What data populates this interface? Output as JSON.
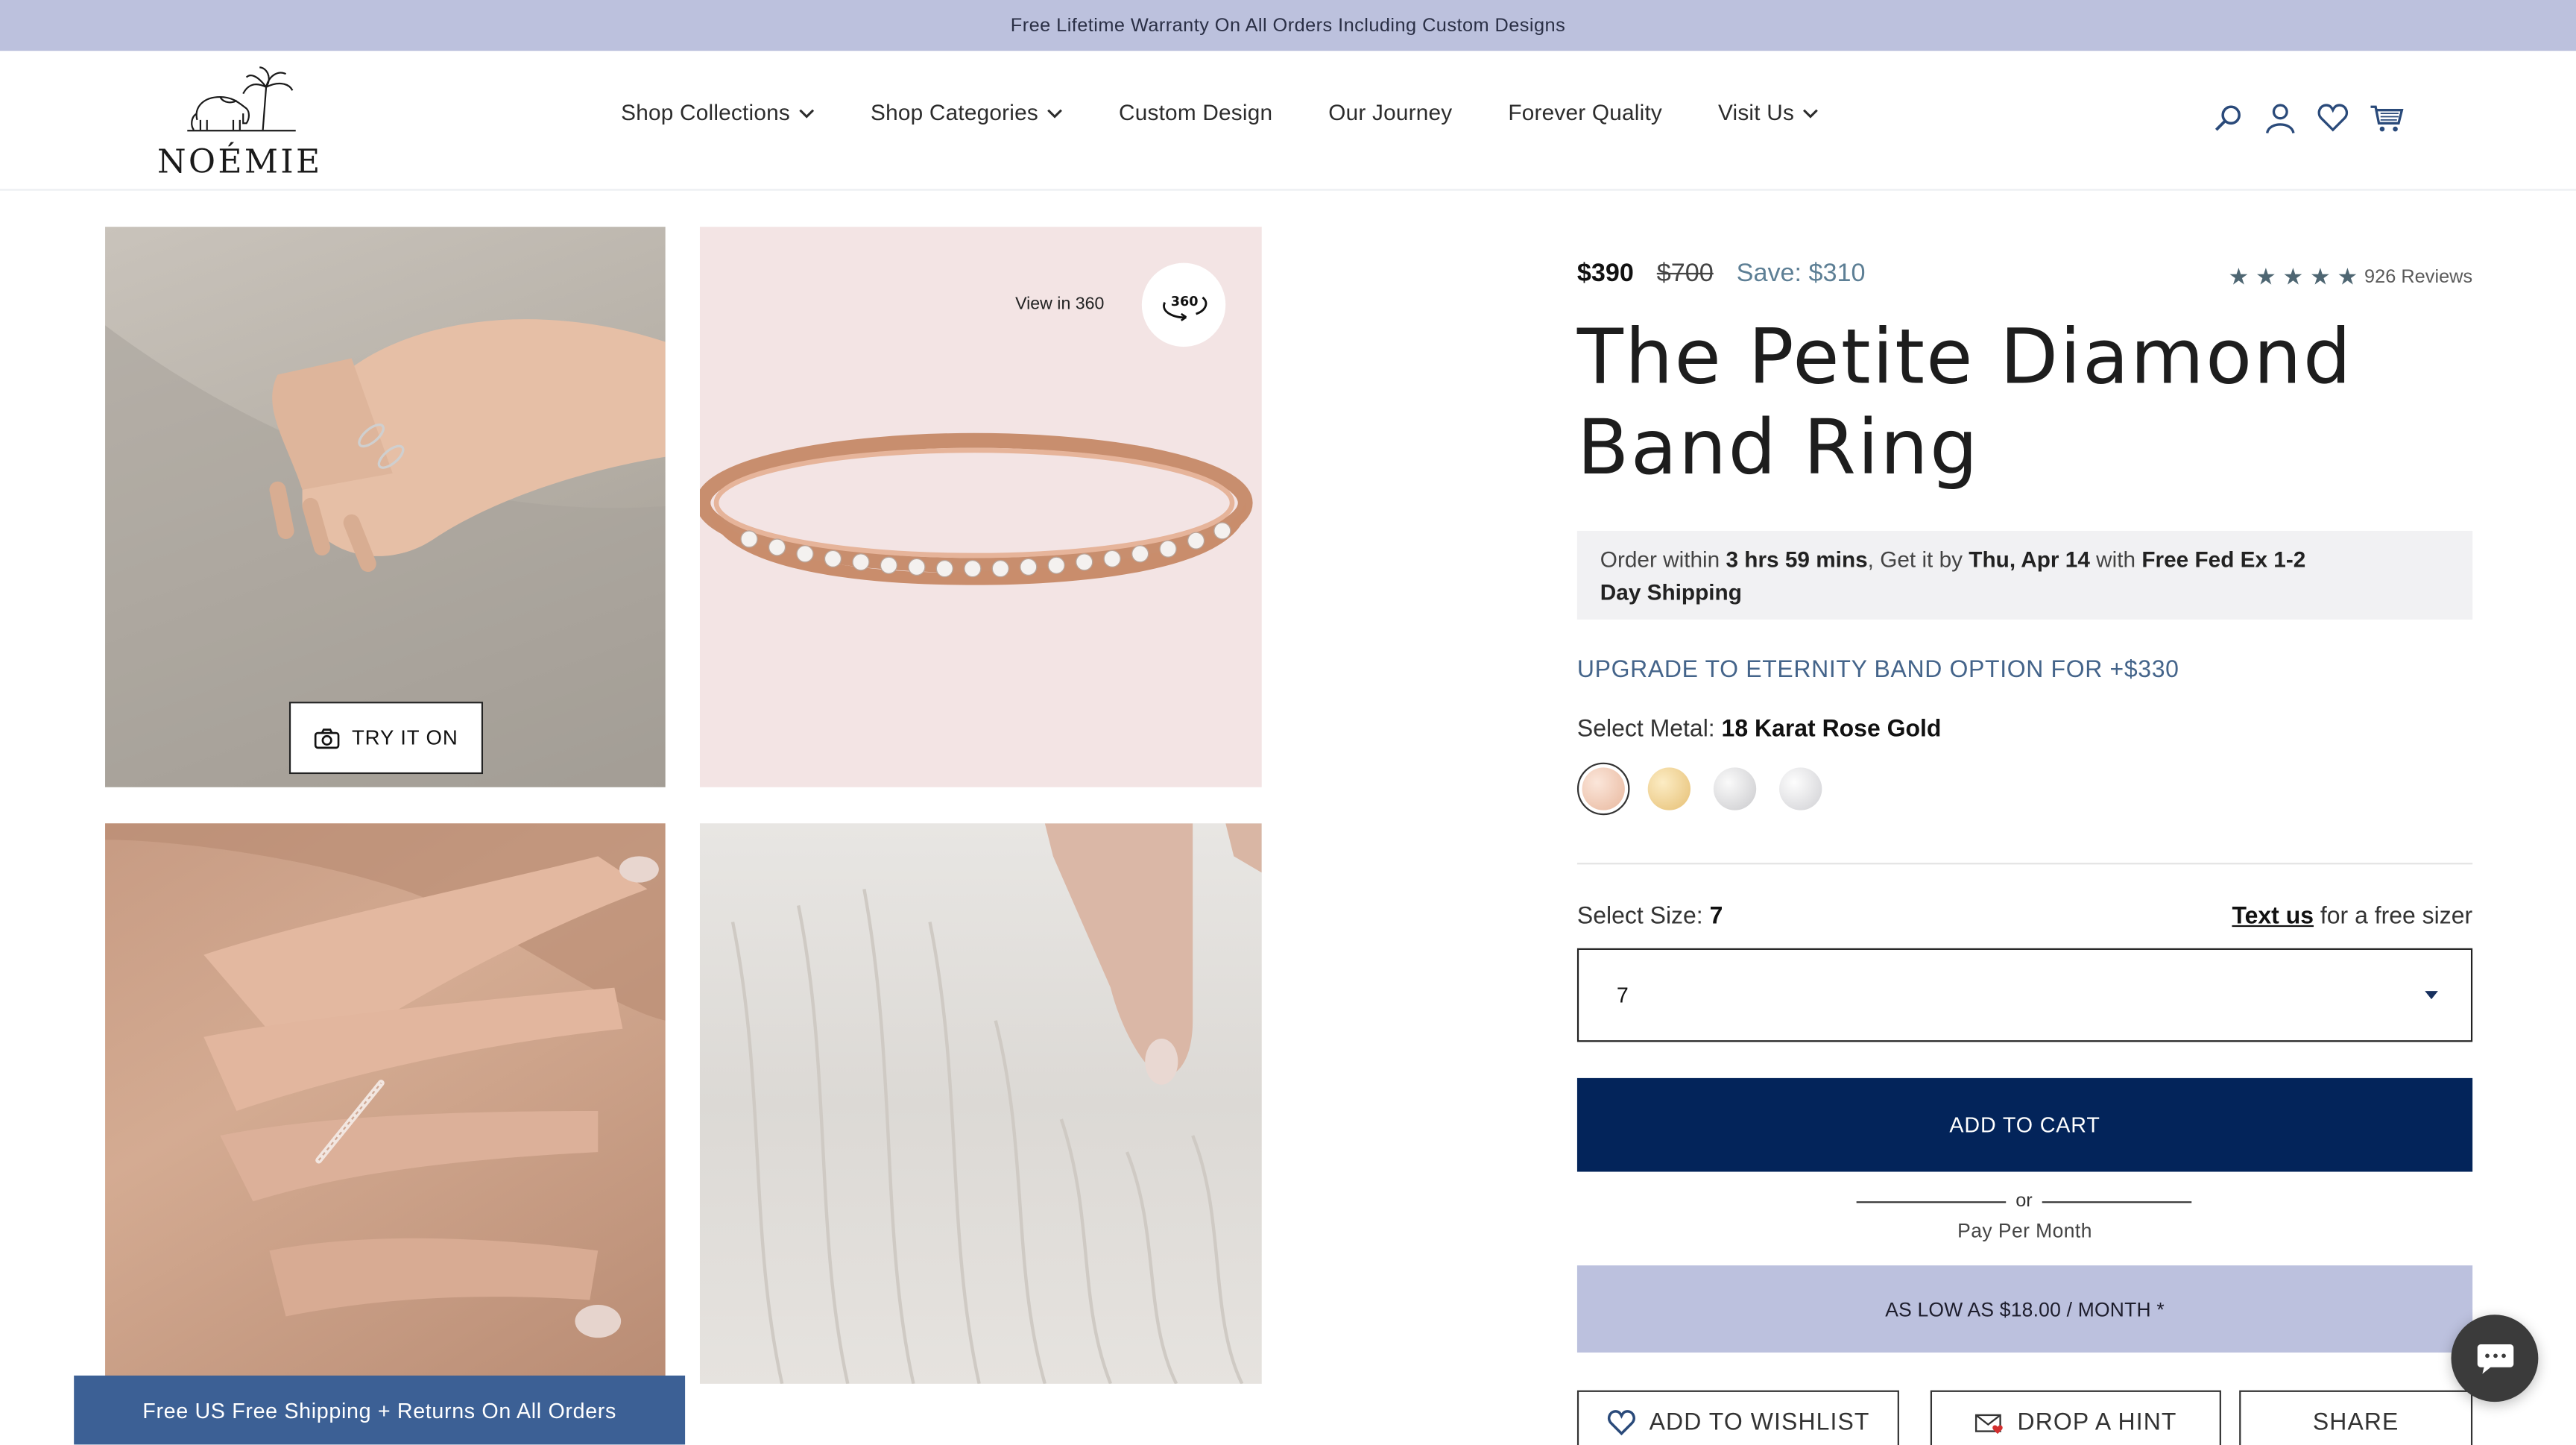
{
  "announcement": "Free Lifetime Warranty On All Orders Including Custom Designs",
  "brand": {
    "name": "NOÉMIE"
  },
  "nav": [
    {
      "label": "Shop Collections",
      "has_dropdown": true
    },
    {
      "label": "Shop Categories",
      "has_dropdown": true
    },
    {
      "label": "Custom Design",
      "has_dropdown": false
    },
    {
      "label": "Our Journey",
      "has_dropdown": false
    },
    {
      "label": "Forever Quality",
      "has_dropdown": false
    },
    {
      "label": "Visit Us",
      "has_dropdown": true
    }
  ],
  "header_icons": [
    "search-icon",
    "account-icon",
    "wishlist-heart-icon",
    "cart-icon"
  ],
  "gallery": {
    "try_on_label": "TRY IT ON",
    "view360_label": "View in 360",
    "view360_badge": "360"
  },
  "shipping_banner": "Free US Free Shipping + Returns On All Orders",
  "product": {
    "price": "$390",
    "old_price": "$700",
    "save": "Save: $310",
    "rating": 5,
    "reviews": "926 Reviews",
    "title_line1": "The Petite Diamond",
    "title_line2": "Band Ring",
    "delivery": {
      "p1": "Order within ",
      "time": "3 hrs 59 mins",
      "p2": ", Get it by ",
      "date": "Thu, Apr 14",
      "p3": " with ",
      "method": "Free Fed Ex 1-2",
      "p4": "Day Shipping"
    },
    "upgrade": "UPGRADE TO ETERNITY BAND OPTION FOR +$330",
    "metal_label": "Select Metal: ",
    "metal_value": "18 Karat Rose Gold",
    "metals": [
      {
        "name": "rose-gold",
        "color": "#f1c9b4",
        "selected": true
      },
      {
        "name": "yellow-gold",
        "color": "#f0d29a",
        "selected": false
      },
      {
        "name": "white-gold",
        "color": "#e4e4e6",
        "selected": false
      },
      {
        "name": "platinum",
        "color": "#e8e8ea",
        "selected": false
      }
    ],
    "size_label": "Select Size: ",
    "size_value": "7",
    "sizer_link": "Text us",
    "sizer_suffix": " for a free sizer",
    "size_select_value": "7",
    "add_to_cart": "ADD TO CART",
    "or": "or",
    "pay_per_month": "Pay Per Month",
    "as_low_as": "AS LOW AS $18.00 / MONTH *",
    "add_to_wishlist": "ADD TO WISHLIST",
    "drop_hint": "DROP A HINT",
    "share": "SHARE"
  },
  "colors": {
    "announcement_bg": "#bcc1dd",
    "primary_navy": "#03245a",
    "accent_blue": "#44648a",
    "shipping_bar": "#3c6095"
  }
}
